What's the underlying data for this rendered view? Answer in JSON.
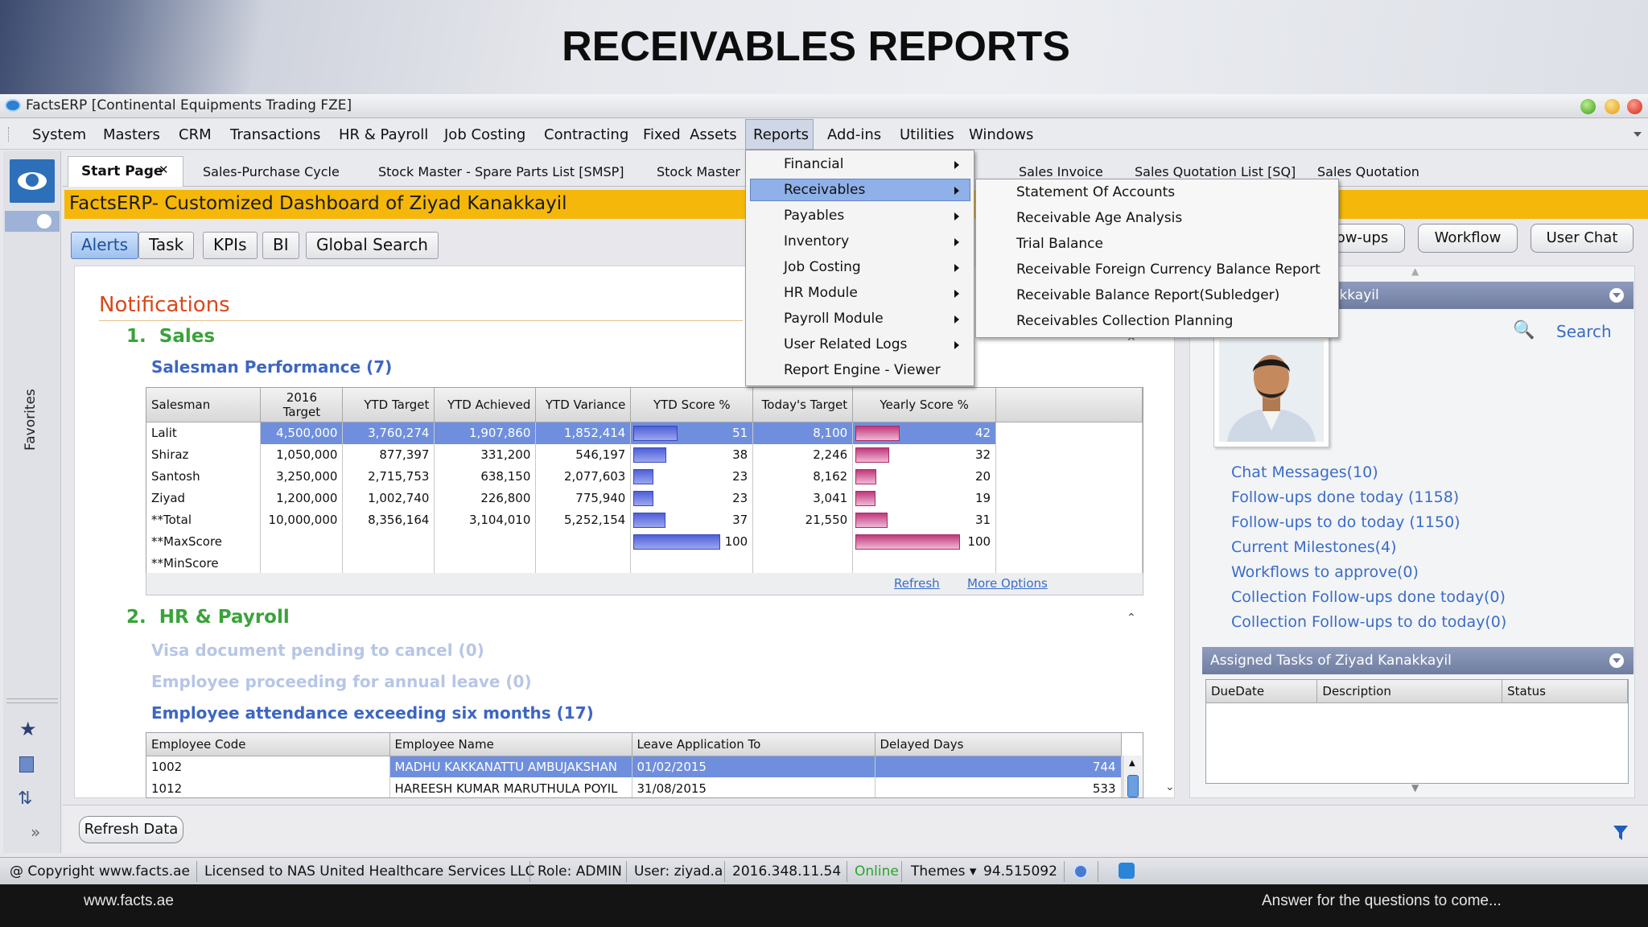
{
  "banner": {
    "title": "RECEIVABLES REPORTS"
  },
  "window": {
    "title": "FactsERP [Continental Equipments Trading FZE]"
  },
  "menubar": [
    "System",
    "Masters",
    "CRM",
    "Transactions",
    "HR & Payroll",
    "Job Costing",
    "Contracting",
    "Fixed  Assets",
    "Reports",
    "Add-ins",
    "Utilities",
    "Windows"
  ],
  "leftbar": {
    "favorites_label": "Favorites"
  },
  "tabs": [
    {
      "label": "Start Page",
      "close": "✕"
    },
    {
      "label": "Sales-Purchase Cycle"
    },
    {
      "label": "Stock Master - Spare Parts List [SMSP]"
    },
    {
      "label": "Stock Master -"
    },
    {
      "label": "Sales Invoice"
    },
    {
      "label": "Sales Quotation List [SQ]"
    },
    {
      "label": "Sales Quotation"
    }
  ],
  "dashboard": {
    "title": "FactsERP- Customized Dashboard of Ziyad Kanakkayil"
  },
  "alert_buttons": [
    "Alerts",
    "Task",
    "KPIs",
    "BI",
    "Global Search"
  ],
  "notifications": {
    "title": "Notifications",
    "sales": {
      "heading": "1.  Sales",
      "subheading": "Salesman Performance (7)",
      "columns": [
        "Salesman",
        "2016 Target",
        "YTD Target",
        "YTD Achieved",
        "YTD Variance",
        "YTD Score %",
        "Today's Target",
        "Yearly Score %"
      ],
      "rows": [
        {
          "name": "Lalit",
          "target": "4,500,000",
          "ytd_target": "3,760,274",
          "ytd_achieved": "1,907,860",
          "ytd_variance": "1,852,414",
          "ytd_score": 51,
          "today_target": "8,100",
          "yearly_score": 42
        },
        {
          "name": "Shiraz",
          "target": "1,050,000",
          "ytd_target": "877,397",
          "ytd_achieved": "331,200",
          "ytd_variance": "546,197",
          "ytd_score": 38,
          "today_target": "2,246",
          "yearly_score": 32
        },
        {
          "name": "Santosh",
          "target": "3,250,000",
          "ytd_target": "2,715,753",
          "ytd_achieved": "638,150",
          "ytd_variance": "2,077,603",
          "ytd_score": 23,
          "today_target": "8,162",
          "yearly_score": 20
        },
        {
          "name": "Ziyad",
          "target": "1,200,000",
          "ytd_target": "1,002,740",
          "ytd_achieved": "226,800",
          "ytd_variance": "775,940",
          "ytd_score": 23,
          "today_target": "3,041",
          "yearly_score": 19
        },
        {
          "name": "**Total",
          "target": "10,000,000",
          "ytd_target": "8,356,164",
          "ytd_achieved": "3,104,010",
          "ytd_variance": "5,252,154",
          "ytd_score": 37,
          "today_target": "21,550",
          "yearly_score": 31
        },
        {
          "name": "**MaxScore",
          "target": "",
          "ytd_target": "",
          "ytd_achieved": "",
          "ytd_variance": "",
          "ytd_score": 100,
          "today_target": "",
          "yearly_score": 100
        },
        {
          "name": "**MinScore",
          "target": "",
          "ytd_target": "",
          "ytd_achieved": "",
          "ytd_variance": "",
          "ytd_score": null,
          "today_target": "",
          "yearly_score": null
        }
      ],
      "refresh_link": "Refresh",
      "more_options_link": "More Options"
    },
    "hr": {
      "heading": "2.  HR & Payroll",
      "item1": "Visa document pending to cancel (0)",
      "item2": "Employee proceeding for annual leave (0)",
      "item3": "Employee attendance exceeding six months (17)",
      "columns": [
        "Employee Code",
        "Employee Name",
        "Leave Application To",
        "Delayed Days"
      ],
      "rows": [
        {
          "code": "1002",
          "name": "MADHU  KAKKANATTU  AMBUJAKSHAN",
          "to": "01/02/2015",
          "days": "744"
        },
        {
          "code": "1012",
          "name": "HAREESH KUMAR MARUTHULA POYIL",
          "to": "31/08/2015",
          "days": "533"
        }
      ]
    }
  },
  "right_panel": {
    "buttons": [
      "ow-ups",
      "Workflow",
      "User Chat"
    ],
    "user_header": "akkayil",
    "search_label": "Search",
    "links": [
      "Chat Messages(10)",
      "Follow-ups done today (1158)",
      "Follow-ups to do today (1150)",
      "Current Milestones(4)",
      "Workflows to approve(0)",
      "Collection Follow-ups done today(0)",
      "Collection Follow-ups to do today(0)"
    ],
    "tasks_header": "Assigned Tasks of Ziyad Kanakkayil",
    "task_columns": [
      "DueDate",
      "Description",
      "Status"
    ]
  },
  "reports_menu": {
    "items": [
      "Financial",
      "Receivables",
      "Payables",
      "Inventory",
      "Job Costing",
      "HR Module",
      "Payroll Module",
      "User Related Logs",
      "Report Engine - Viewer"
    ],
    "receivables_submenu": [
      "Statement Of Accounts",
      "Receivable Age Analysis",
      "Trial Balance",
      "Receivable Foreign Currency Balance Report",
      "Receivable Balance Report(Subledger)",
      "Receivables Collection Planning"
    ]
  },
  "bottom": {
    "refresh_data": "Refresh Data"
  },
  "statusbar": {
    "copyright": "@ Copyright www.facts.ae",
    "license": "Licensed to NAS United Healthcare Services LLC",
    "role": "Role: ADMIN",
    "user": "User: ziyad.a",
    "version": "2016.348.11.54",
    "online": "Online",
    "themes": "Themes ▾",
    "number": "94.515092"
  },
  "caption": {
    "left": "www.facts.ae",
    "right": "Answer for the questions to come..."
  },
  "colors": {
    "accent": "#f5b70a",
    "online": "#2aa52a",
    "link": "#3a6cc8",
    "section_green": "#3aa33a",
    "notif_orange": "#d9481b"
  }
}
